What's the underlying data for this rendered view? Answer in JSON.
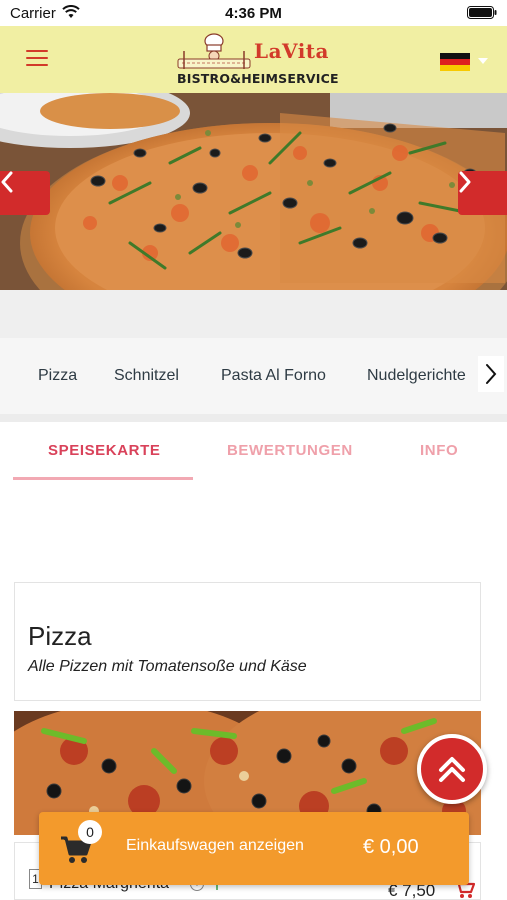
{
  "status_bar": {
    "carrier": "Carrier",
    "time": "4:36 PM"
  },
  "header": {
    "logo_name": "LaVita",
    "logo_subtitle": "BISTRO&HEIMSERVICE",
    "language": "de"
  },
  "categories": [
    "Pizza",
    "Schnitzel",
    "Pasta Al Forno",
    "Nudelgerichte"
  ],
  "tabs": {
    "menu": "SPEISEKARTE",
    "reviews": "BEWERTUNGEN",
    "info": "INFO"
  },
  "category_section": {
    "title": "Pizza",
    "description": "Alle Pizzen mit Tomatensoße und Käse"
  },
  "product": {
    "quantity": "1",
    "name": "Pizza Margherita",
    "price": "€ 7,50"
  },
  "cart": {
    "count": "0",
    "label": "Einkaufswagen anzeigen",
    "total": "€ 0,00"
  },
  "colors": {
    "header_bg": "#f1efa3",
    "accent_red": "#d22b2b",
    "tab_active": "#d9425a",
    "cart_orange": "#f39a2c"
  }
}
